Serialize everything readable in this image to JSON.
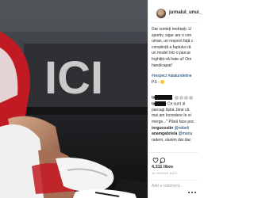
{
  "post": {
    "username": "jurnalul_unui_",
    "caption_lines": [
      "Dar sunteți nedrepți. U",
      "sportiv, sigur are o con",
      "uman, un respect față c",
      "conștiință a faptului că",
      "un model într-o parcar",
      "înghițiți-vă hate-ul! Om",
      "handicapat!"
    ],
    "hashtag_lines": [
      "#respect #alaturidetine",
      "PS -"
    ],
    "comments": [
      {
        "text": "",
        "emojis": 4
      },
      {
        "text": "Ce sunt al"
      },
      {
        "text": "parcagi ăștia..bine că"
      },
      {
        "text": "mai am încredere în ei"
      },
      {
        "text": "merge...\" Până face poc"
      },
      {
        "user": "iorgucostin",
        "text": "@nobeli"
      },
      {
        "user": "anamgabriela",
        "text": "@mariu"
      },
      {
        "text": "radem, olunim dar dac"
      }
    ],
    "likes": "4,311 likes",
    "time": "16 HOURS AGO",
    "add_comment_placeholder": "Add a comment..."
  }
}
